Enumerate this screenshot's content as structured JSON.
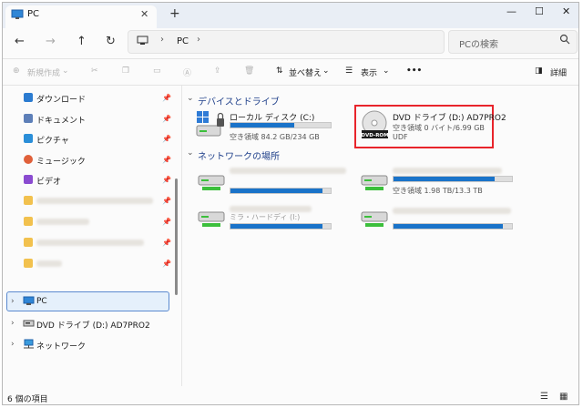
{
  "tab": {
    "title": "PC"
  },
  "address": {
    "location": "PC"
  },
  "search": {
    "placeholder": "PCの検索"
  },
  "toolbar": {
    "new_label": "新規作成",
    "sort_label": "並べ替え",
    "view_label": "表示",
    "more_label": "•••",
    "details_label": "詳細"
  },
  "sidebar": {
    "quick": [
      "ダウンロード",
      "ドキュメント",
      "ピクチャ",
      "ミュージック",
      "ビデオ"
    ],
    "pc_label": "PC",
    "dvd_label": "DVD ドライブ (D:) AD7PRO2",
    "network_label": "ネットワーク"
  },
  "groups": {
    "devices": "デバイスとドライブ",
    "network": "ネットワークの場所"
  },
  "drives": [
    {
      "name": "ローカル ディスク (C:)",
      "free": "空き領域 84.2 GB/234 GB",
      "used_fraction": 0.64
    },
    {
      "name": "DVD ドライブ (D:) AD7PRO2",
      "free": "空き領域 0 バイト/6.99 GB",
      "fs": "UDF",
      "label": "DVD-ROM"
    }
  ],
  "network_drives": [
    {
      "name": "",
      "free": "",
      "used_fraction": 0.92
    },
    {
      "name": "",
      "free": "空き領域 1.98 TB/13.3 TB",
      "used_fraction": 0.85
    },
    {
      "name": "ミラ・ハードディ (I:)",
      "free": "",
      "used_fraction": 0.92
    },
    {
      "name": "",
      "free": "",
      "used_fraction": 0.92
    }
  ],
  "status": {
    "count": "6 個の項目"
  },
  "colors": {
    "accent": "#1a73c9",
    "highlight": "#e8242b"
  }
}
